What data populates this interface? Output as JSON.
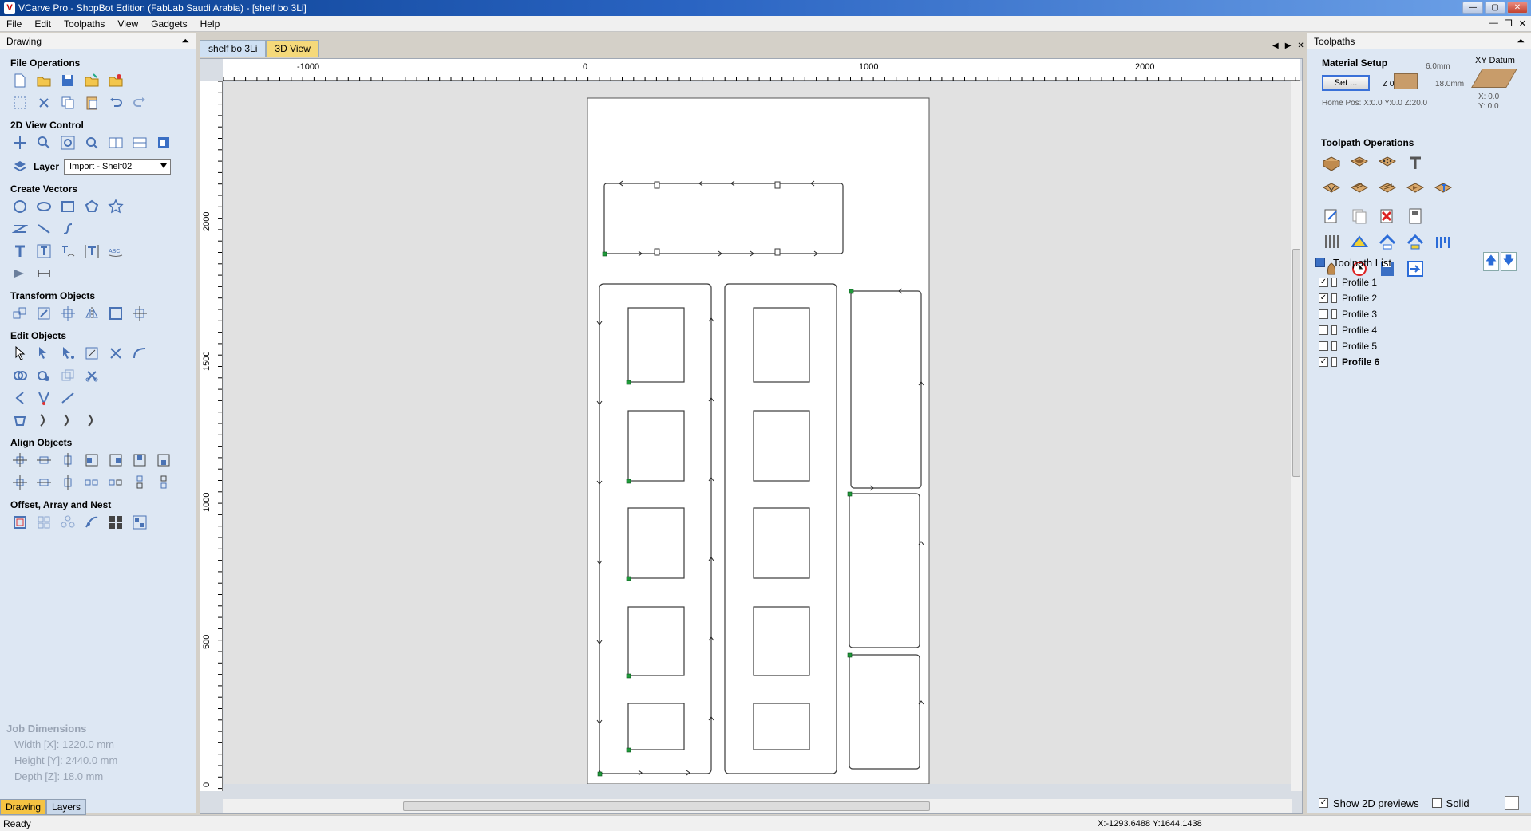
{
  "window": {
    "title": "VCarve Pro - ShopBot Edition (FabLab Saudi Arabia) - [shelf bo 3Li]"
  },
  "menu": [
    "File",
    "Edit",
    "Toolpaths",
    "View",
    "Gadgets",
    "Help"
  ],
  "left_panel": {
    "header": "Drawing",
    "sections": {
      "file_ops": "File Operations",
      "view_ctrl": "2D View Control",
      "create_vectors": "Create Vectors",
      "transform": "Transform Objects",
      "edit": "Edit Objects",
      "align": "Align Objects",
      "offset": "Offset, Array and Nest"
    },
    "layer_label": "Layer",
    "layer_value": "Import - Shelf02",
    "job_dimensions": {
      "title": "Job Dimensions",
      "width": "Width  [X]: 1220.0 mm",
      "height": "Height [Y]: 2440.0 mm",
      "depth": "Depth  [Z]: 18.0 mm"
    },
    "tabs": [
      "Drawing",
      "Layers"
    ]
  },
  "doc_tabs": [
    "shelf bo 3Li",
    "3D View"
  ],
  "rulers": {
    "h": [
      "-1000",
      "0",
      "1000",
      "2000"
    ],
    "v": [
      "2000",
      "1500",
      "1000",
      "500",
      "0"
    ]
  },
  "right_panel": {
    "header": "Toolpaths",
    "material_setup": "Material Setup",
    "set_button": "Set ...",
    "z0": "Z 0",
    "thickness_top": "6.0mm",
    "thickness_total": "18.0mm",
    "home_pos": "Home Pos:  X:0.0 Y:0.0 Z:20.0",
    "xy_datum": "XY Datum",
    "xy_x": "X: 0.0",
    "xy_y": "Y: 0.0",
    "toolpath_ops": "Toolpath Operations",
    "toolpath_list_title": "Toolpath List",
    "toolpaths": [
      {
        "name": "Profile 1",
        "checked": true,
        "bold": false
      },
      {
        "name": "Profile 2",
        "checked": true,
        "bold": false
      },
      {
        "name": "Profile 3",
        "checked": false,
        "bold": false
      },
      {
        "name": "Profile 4",
        "checked": false,
        "bold": false
      },
      {
        "name": "Profile 5",
        "checked": false,
        "bold": false
      },
      {
        "name": "Profile 6",
        "checked": true,
        "bold": true
      }
    ],
    "show_previews": "Show 2D previews",
    "solid": "Solid"
  },
  "status": {
    "left": "Ready",
    "coords": "X:-1293.6488 Y:1644.1438"
  }
}
